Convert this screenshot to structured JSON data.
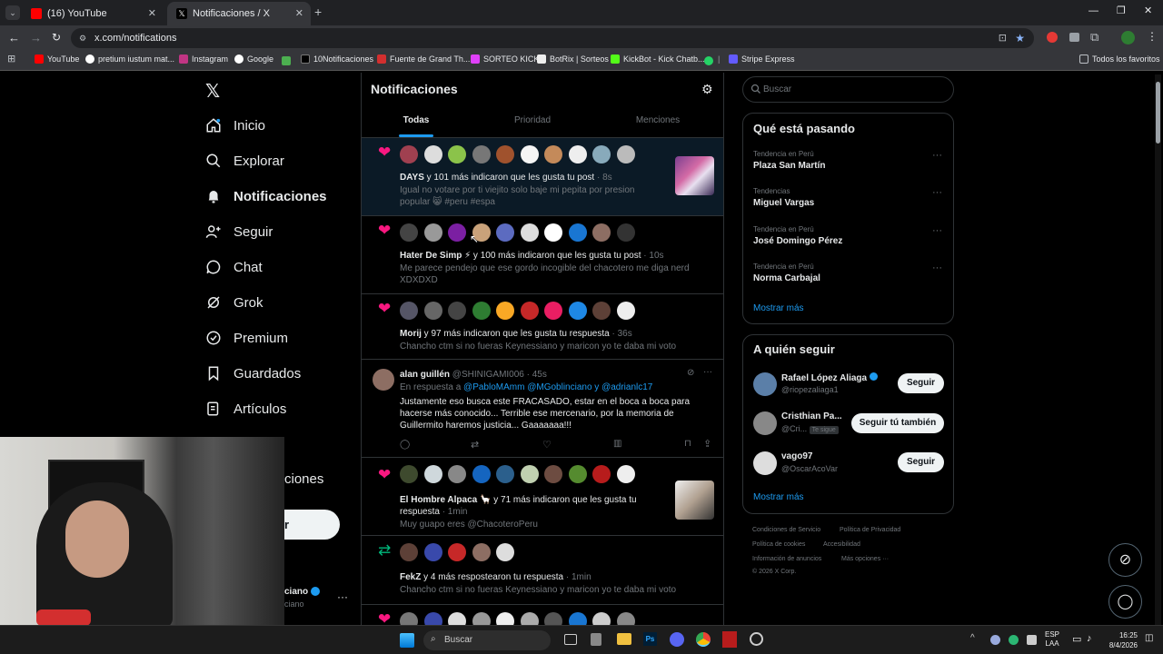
{
  "browser": {
    "tabs": [
      {
        "title": "(16) YouTube"
      },
      {
        "title": "Notificaciones / X"
      }
    ],
    "url": "x.com/notifications",
    "bookmarks": [
      "YouTube",
      "pretium iustum mat...",
      "Instagram",
      "Google",
      "10Notificaciones",
      "Fuente de Grand Th...",
      "SORTEO KICK",
      "BotRix | Sorteos",
      "KickBot - Kick Chatb...",
      "Stripe Express"
    ],
    "bookmark_all": "Todos los favoritos"
  },
  "sidebar": {
    "items": [
      {
        "label": "Inicio",
        "icon": "home-icon"
      },
      {
        "label": "Explorar",
        "icon": "search-icon"
      },
      {
        "label": "Notificaciones",
        "icon": "bell-icon"
      },
      {
        "label": "Seguir",
        "icon": "person-add-icon"
      },
      {
        "label": "Chat",
        "icon": "chat-icon"
      },
      {
        "label": "Grok",
        "icon": "grok-icon"
      },
      {
        "label": "Premium",
        "icon": "premium-icon"
      },
      {
        "label": "Guardados",
        "icon": "bookmark-icon"
      },
      {
        "label": "Artículos",
        "icon": "articles-icon"
      }
    ],
    "partial_more": "ciones",
    "post_btn_partial": "r",
    "account_partial": "ciano",
    "account_handle_partial": "ciano"
  },
  "header": {
    "title": "Notificaciones",
    "tabs": [
      "Todas",
      "Prioridad",
      "Menciones"
    ]
  },
  "notifications": [
    {
      "user": "DAYS",
      "text": " y 101 más indicaron que les gusta tu post",
      "time": "· 8s",
      "body": "Igual no votare por ti viejito solo baje mi pepita por presion popular 😸 #peru #espa"
    },
    {
      "user": "Hater De Simp ⚡",
      "text": " y 100 más indicaron que les gusta tu post",
      "time": "· 10s",
      "body": "Me parece pendejo que ese gordo incogible del chacotero me diga nerd XDXDXD"
    },
    {
      "user": "Morij",
      "text": " y 97 más indicaron que les gusta tu respuesta",
      "time": "· 36s",
      "body": "Chancho ctm si no fueras Keynessiano y maricon yo te daba mi voto"
    },
    {
      "user": "El Hombre Alpaca 🦙",
      "text": " y 71 más indicaron que les gusta tu respuesta",
      "time": "· 1min",
      "body": "Muy guapo eres @ChacoteroPeru"
    },
    {
      "user": "FekZ",
      "text": " y 4 más respostearon tu respuesta",
      "time": "· 1min",
      "body": "Chancho ctm si no fueras Keynessiano y maricon yo te daba mi voto"
    }
  ],
  "reply": {
    "name": "alan guillén",
    "handle": "@SHINIGAMI006 · 45s",
    "in_reply": "En respuesta a ",
    "mentions": "@PabloMAmm @MGoblinciano y @adrianlc17",
    "body": "Justamente eso busca este FRACASADO, estar en el boca a boca para hacerse más conocido... Terrible ese mercenario, por la memoria de Guillermito haremos justicia... Gaaaaaaa!!!"
  },
  "search": {
    "placeholder": "Buscar"
  },
  "trends": {
    "title": "Qué está pasando",
    "items": [
      {
        "cat": "Tendencia en Perú",
        "name": "Plaza San Martín"
      },
      {
        "cat": "Tendencias",
        "name": "Miguel Vargas"
      },
      {
        "cat": "Tendencia en Perú",
        "name": "José Domingo Pérez"
      },
      {
        "cat": "Tendencia en Perú",
        "name": "Norma Carbajal"
      }
    ],
    "more": "Mostrar más"
  },
  "follow": {
    "title": "A quién seguir",
    "items": [
      {
        "name": "Rafael López Aliaga",
        "handle": "@riopezaliaga1",
        "btn": "Seguir"
      },
      {
        "name": "Cristhian Pa...",
        "handle": "@Cri...",
        "badge": "Te sigue",
        "btn": "Seguir tú también"
      },
      {
        "name": "vago97",
        "handle": "@OscarAcoVar",
        "btn": "Seguir"
      }
    ],
    "more": "Mostrar más"
  },
  "footer": {
    "links": [
      "Condiciones de Servicio",
      "Política de Privacidad",
      "Política de cookies",
      "Accesibilidad",
      "Información de anuncios",
      "Más opciones ···"
    ],
    "copy": "© 2026 X Corp."
  },
  "taskbar": {
    "search": "Buscar",
    "lang1": "ESP",
    "lang2": "LAA",
    "time": "16:25",
    "date": "8/4/2026"
  },
  "colors": {
    "accent": "#1d9bf0",
    "like": "#f91880",
    "repost": "#00ba7c"
  }
}
